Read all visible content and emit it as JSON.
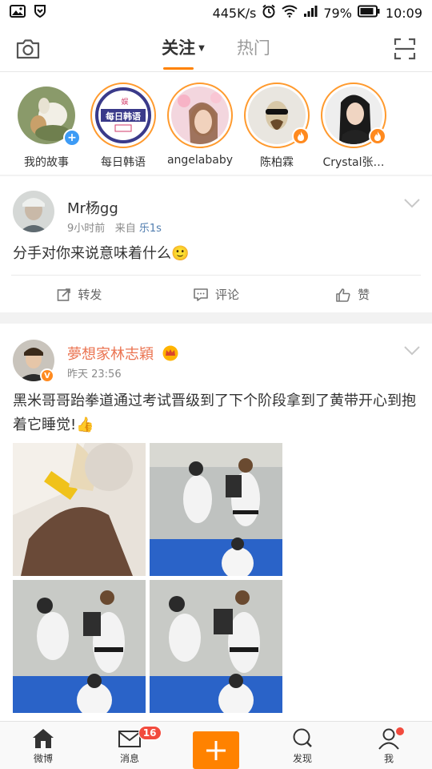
{
  "status_bar": {
    "speed": "445K/s",
    "battery_pct": "79%",
    "time": "10:09"
  },
  "top_nav": {
    "tabs": [
      {
        "label": "关注",
        "active": true
      },
      {
        "label": "热门",
        "active": false
      }
    ]
  },
  "stories": [
    {
      "name": "我的故事",
      "badge": "add"
    },
    {
      "name": "每日韩语",
      "badge": "none",
      "logo_text": "每日韩语"
    },
    {
      "name": "angelababy",
      "badge": "none"
    },
    {
      "name": "陈柏霖",
      "badge": "fire"
    },
    {
      "name": "Crystal张…",
      "badge": "fire"
    }
  ],
  "posts": [
    {
      "user": "Mr杨gg",
      "time": "9小时前",
      "source_prefix": "来自",
      "source": "乐1s",
      "text": "分手对你来说意味着什么🙂",
      "actions": {
        "repost": "转发",
        "comment": "评论",
        "like": "赞"
      }
    },
    {
      "user": "夢想家林志穎",
      "time": "昨天 23:56",
      "text": "黑米哥哥跆拳道通过考试晋级到了下个阶段拿到了黄带开心到抱着它睡觉!👍"
    }
  ],
  "bottom_nav": {
    "items": [
      {
        "label": "微博",
        "icon": "home-icon"
      },
      {
        "label": "消息",
        "icon": "mail-icon",
        "badge": "16"
      },
      {
        "label": "",
        "icon": "plus-icon"
      },
      {
        "label": "发现",
        "icon": "search-icon"
      },
      {
        "label": "我",
        "icon": "profile-icon"
      }
    ]
  },
  "colors": {
    "accent": "#ff8200",
    "link": "#507daf",
    "vip_name": "#eb7350",
    "badge_red": "#f24b3e"
  }
}
